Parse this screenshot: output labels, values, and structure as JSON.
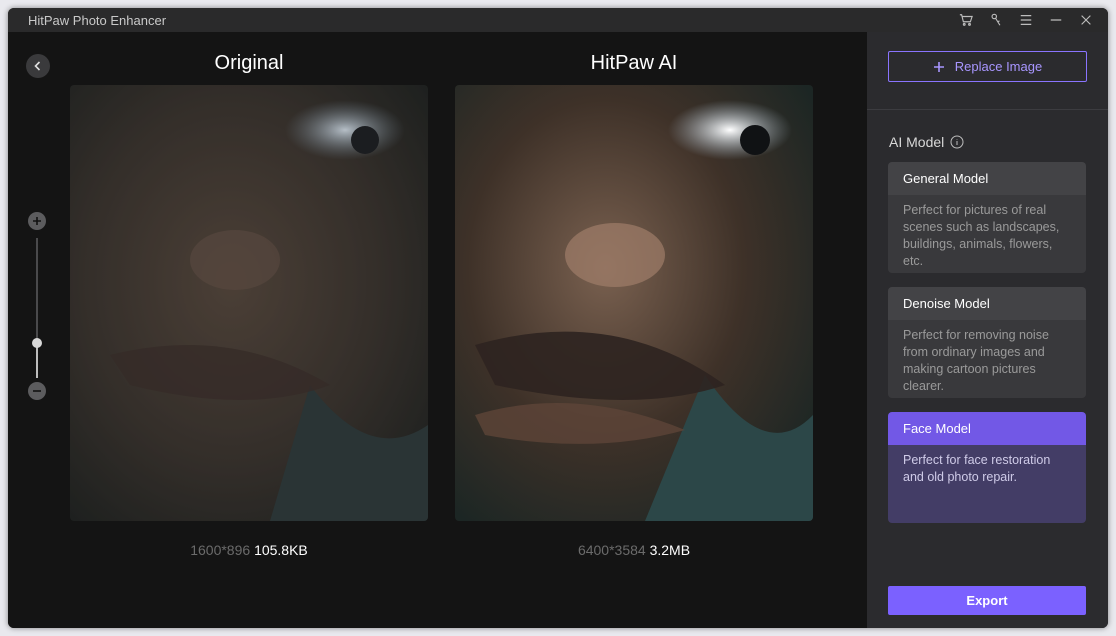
{
  "app": {
    "title": "HitPaw Photo Enhancer"
  },
  "titlebar": {
    "icons": [
      "cart-icon",
      "key-icon",
      "menu-icon",
      "minimize-icon",
      "close-icon"
    ]
  },
  "compare": {
    "left": {
      "title": "Original",
      "dimensions": "1600*896",
      "size": "105.8KB"
    },
    "right": {
      "title": "HitPaw AI",
      "dimensions": "6400*3584",
      "size": "3.2MB"
    }
  },
  "zoom": {
    "level_fraction": 0.25
  },
  "sidebar": {
    "replace_label": "Replace Image",
    "ai_model_label": "AI Model",
    "models": [
      {
        "name": "General Model",
        "description": "Perfect for pictures of real scenes such as landscapes, buildings, animals, flowers, etc.",
        "selected": false
      },
      {
        "name": "Denoise Model",
        "description": "Perfect for removing noise from ordinary images and making cartoon pictures clearer.",
        "selected": false
      },
      {
        "name": "Face Model",
        "description": "Perfect for face restoration and old photo repair.",
        "selected": true
      }
    ],
    "export_label": "Export"
  },
  "colors": {
    "accent": "#7b61ff",
    "window_bg": "#141414",
    "sidebar_bg": "#2b2b2e"
  }
}
